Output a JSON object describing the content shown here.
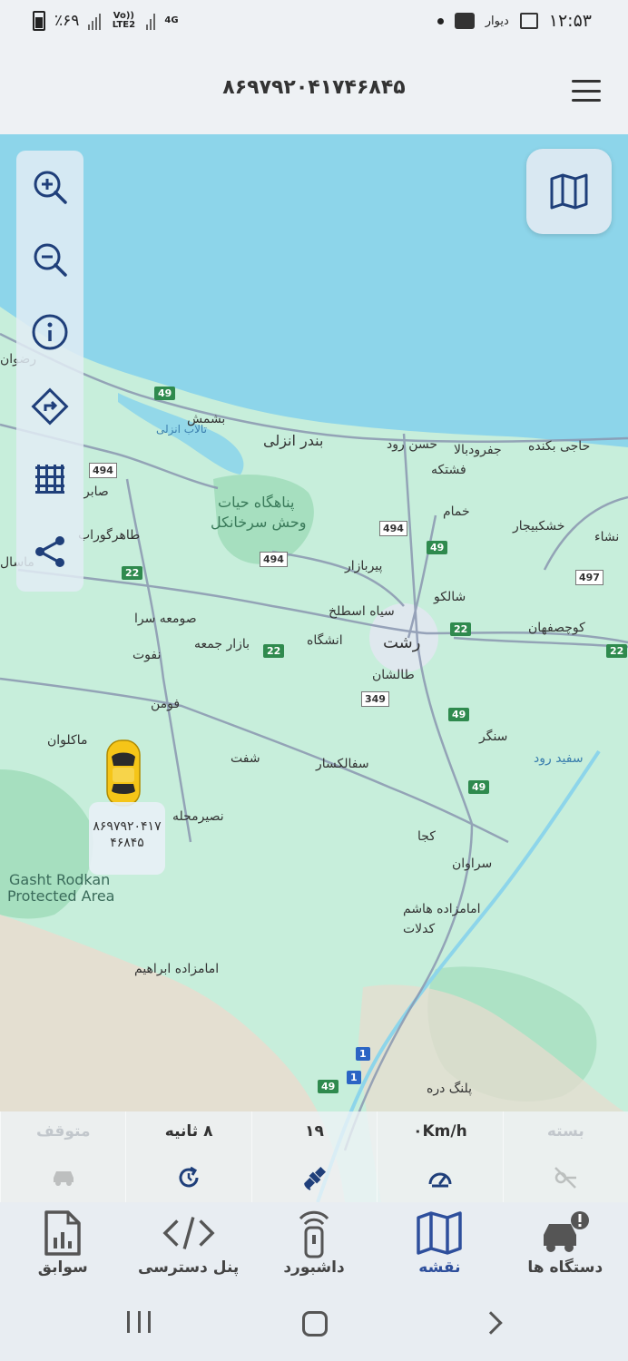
{
  "status_bar": {
    "time": "۱۲:۵۳",
    "battery": "٪۶۹",
    "network_volte": "Vo)) LTE2",
    "network_4g": "4G",
    "notification_app": "دیوار"
  },
  "header": {
    "title": "۸۶۹۷۹۲۰۴۱۷۴۶۸۴۵",
    "menu_icon": "hamburger-icon"
  },
  "map": {
    "controls": [
      {
        "name": "zoom-in",
        "icon": "zoom-in-icon"
      },
      {
        "name": "zoom-out",
        "icon": "zoom-out-icon"
      },
      {
        "name": "info",
        "icon": "info-icon"
      },
      {
        "name": "directions",
        "icon": "directions-icon"
      },
      {
        "name": "grid",
        "icon": "grid-icon"
      },
      {
        "name": "share",
        "icon": "share-icon"
      }
    ],
    "map_type_icon": "map-icon",
    "vehicle": {
      "label_line1": "۸۶۹۷۹۲۰۴۱۷",
      "label_line2": "۴۶۸۴۵",
      "color": "#f5c518"
    },
    "place_labels": {
      "bandar_anzali": "بندر انزلی",
      "hasan_rud": "حسن رود",
      "jafrood": "جفرودبالا",
      "haji_bakandeh": "حاجی بکنده",
      "fashtakeh": "فشتکه",
      "pahnagah": "پناهگاه حیات",
      "vahsh": "وحش سرخانکل",
      "khomam": "خمام",
      "khoshk_bijar": "خشکبیجار",
      "pir_bazar": "پیربازار",
      "shalku": "شالکو",
      "siah_estalakh": "سیاه اسطلخ",
      "rasht": "رشت",
      "koochesfahan": "کوچصفهان",
      "someh_sara": "صومعه سرا",
      "bazar_jomeh": "بازار جمعه",
      "enshagah": "انشگاه",
      "taleshan": "طالشان",
      "nafoot": "نفوت",
      "foman": "فومن",
      "makloan": "ماکلوان",
      "shaft": "شفت",
      "sangar": "سنگر",
      "sefid_rud": "سفید رود",
      "safalkasar": "سفالکسار",
      "nasirmahalleh": "نصیرمحله",
      "koja": "کجا",
      "saravan": "سراوان",
      "emamzadeh_hashem": "امامزاده هاشم",
      "kadelat": "کدلات",
      "gasht_rodkhan": "Gasht Rodkan",
      "protected_area": "Protected Area",
      "emamzadeh_ebrahim": "امامزاده ابراهیم",
      "palang_dareh": "پلنگ دره",
      "tavalesh_lagoon": "تالاب انزلی",
      "shemshan": "بشمش",
      "sabir": "صابر",
      "taherguraab": "طاهرگوراب",
      "masal": "ماسال",
      "rezvan": "رضوان",
      "nesa": "نشاء"
    },
    "road_shields": [
      "49",
      "494",
      "494",
      "494",
      "22",
      "22",
      "22",
      "22",
      "49",
      "49",
      "49",
      "349",
      "497",
      "1",
      "1",
      "49"
    ]
  },
  "info_strip": [
    {
      "name": "status",
      "value": "متوقف",
      "icon": "car-icon",
      "dim": true
    },
    {
      "name": "update-interval",
      "value": "۸ ثانیه",
      "icon": "refresh-icon",
      "dim": false
    },
    {
      "name": "satellites",
      "value": "۱۹",
      "icon": "satellite-icon",
      "dim": false
    },
    {
      "name": "speed",
      "value": "۰Km/h",
      "icon": "speedometer-icon",
      "dim": false
    },
    {
      "name": "ignition",
      "value": "بسته",
      "icon": "key-off-icon",
      "dim": true
    }
  ],
  "bottom_nav": [
    {
      "name": "devices",
      "label": "دستگاه ها",
      "icon": "car-alert-icon",
      "active": false
    },
    {
      "name": "map",
      "label": "نقشه",
      "icon": "map-icon",
      "active": true
    },
    {
      "name": "dashboard",
      "label": "داشبورد",
      "icon": "remote-icon",
      "active": false
    },
    {
      "name": "access-panel",
      "label": "پنل دسترسی",
      "icon": "code-icon",
      "active": false
    },
    {
      "name": "history",
      "label": "سوابق",
      "icon": "report-icon",
      "active": false
    }
  ],
  "colors": {
    "sea": "#8dd5ea",
    "land": "#c7eedb",
    "forest": "#a6dfbf",
    "mountain": "#e9dccf",
    "road": "#8a96b0",
    "accent": "#2e4f9c"
  }
}
